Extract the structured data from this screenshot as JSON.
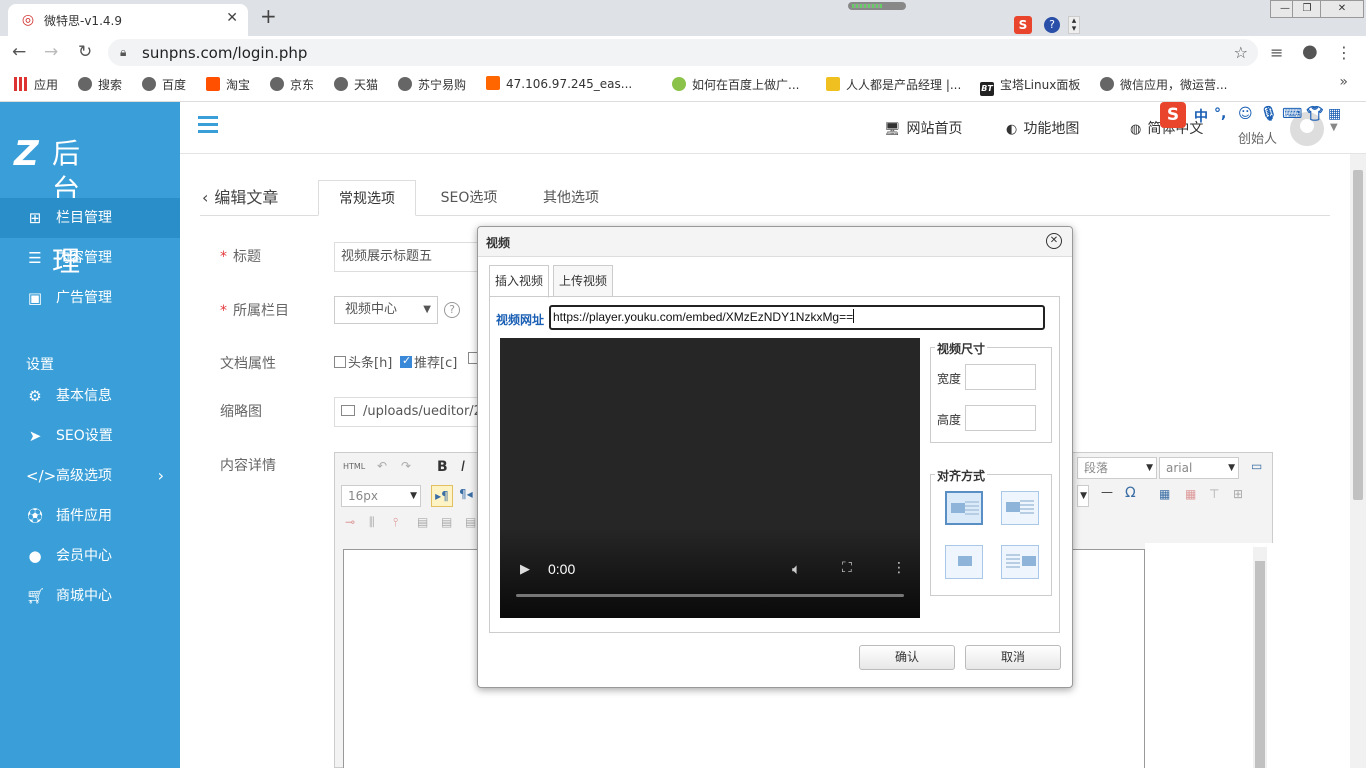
{
  "browser": {
    "tab_title": "微特思-v1.4.9",
    "url": "sunpns.com/login.php",
    "bookmarks": [
      {
        "label": "应用"
      },
      {
        "label": "搜索"
      },
      {
        "label": "百度"
      },
      {
        "label": "淘宝"
      },
      {
        "label": "京东"
      },
      {
        "label": "天猫"
      },
      {
        "label": "苏宁易购"
      },
      {
        "label": "47.106.97.245_eas..."
      },
      {
        "label": "如何在百度上做广..."
      },
      {
        "label": "人人都是产品经理 |..."
      },
      {
        "label": "宝塔Linux面板"
      },
      {
        "label": "微信应用，微运营..."
      }
    ]
  },
  "ime": {
    "lang": "中",
    "punct": "°,"
  },
  "sidebar": {
    "logo_text": "后台管理",
    "items": [
      {
        "label": "栏目管理",
        "icon": "sitemap-icon"
      },
      {
        "label": "内容管理",
        "icon": "list-icon"
      },
      {
        "label": "广告管理",
        "icon": "image-icon"
      }
    ],
    "section_title": "设置",
    "settings": [
      {
        "label": "基本信息",
        "icon": "gear-icon"
      },
      {
        "label": "SEO设置",
        "icon": "paper-plane-icon"
      },
      {
        "label": "高级选项",
        "icon": "code-icon"
      },
      {
        "label": "插件应用",
        "icon": "soccer-icon"
      },
      {
        "label": "会员中心",
        "icon": "user-icon"
      },
      {
        "label": "商城中心",
        "icon": "cart-icon"
      }
    ]
  },
  "topbar": {
    "site_home": "网站首页",
    "feature_map": "功能地图",
    "language": "简体中文",
    "user": "创始人"
  },
  "page": {
    "back_label": "编辑文章",
    "tabs": [
      "常规选项",
      "SEO选项",
      "其他选项"
    ],
    "title_label": "标题",
    "title_value": "视频展示标题五",
    "column_label": "所属栏目",
    "column_value": "视频中心",
    "attr_label": "文档属性",
    "attr_headline": "头条[h]",
    "attr_recommend": "推荐[c]",
    "thumb_label": "缩略图",
    "thumb_value": "/uploads/ueditor/2",
    "content_label": "内容详情"
  },
  "editor": {
    "html_btn": "HTML",
    "font_size": "16px",
    "paragraph": "段落",
    "font_family": "arial"
  },
  "modal": {
    "title": "视频",
    "tab_insert": "插入视频",
    "tab_upload": "上传视频",
    "url_label": "视频网址",
    "url_value": "https://player.youku.com/embed/XMzEzNDY1NzkxMg==",
    "video_time": "0:00",
    "size_legend": "视频尺寸",
    "width_label": "宽度",
    "height_label": "高度",
    "align_legend": "对齐方式",
    "confirm": "确认",
    "cancel": "取消"
  }
}
